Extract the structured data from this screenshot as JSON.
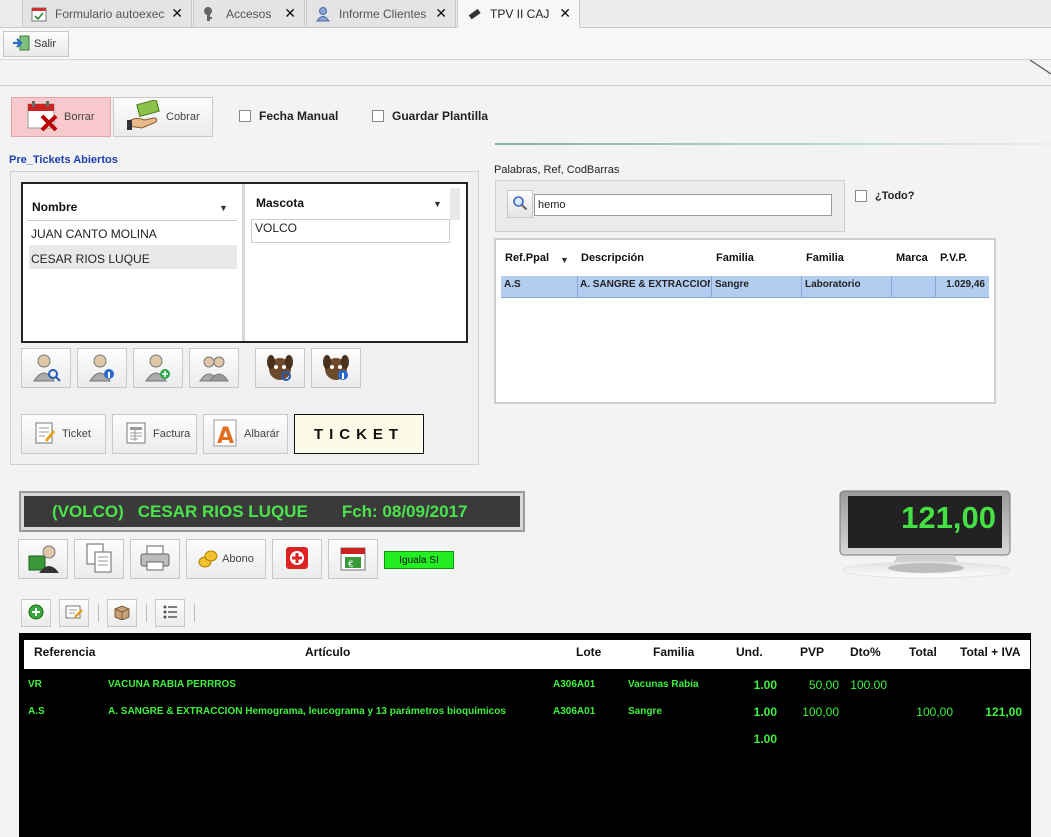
{
  "tabs": [
    {
      "label": "Formulario autoexec",
      "icon": "calendar-check-icon"
    },
    {
      "label": "Accesos",
      "icon": "key-icon"
    },
    {
      "label": "Informe Clientes",
      "icon": "user-icon"
    },
    {
      "label": "TPV II CAJ",
      "icon": "usb-stick-icon"
    }
  ],
  "toolbar": {
    "salir": "Salir"
  },
  "actions": {
    "borrar": "Borrar",
    "cobrar": "Cobrar",
    "fecha_manual": "Fecha Manual",
    "guardar_plantilla": "Guardar Plantilla"
  },
  "pretickets": {
    "title": "Pre_Tickets Abiertos",
    "col_nombre": "Nombre",
    "col_mascota": "Mascota",
    "clients": [
      "JUAN CANTO MOLINA",
      "CESAR RIOS LUQUE"
    ],
    "pets": [
      "VOLCO"
    ]
  },
  "docs": {
    "ticket": "Ticket",
    "factura": "Factura",
    "albaran": "Albarár",
    "ticket_big": "TICKET"
  },
  "search": {
    "label": "Palabras, Ref, CodBarras",
    "value": "hemo",
    "todo_label": "¿Todo?",
    "headers": [
      "Ref.Ppal",
      "Descripción",
      "Familia",
      "Familia",
      "Marca",
      "P.V.P."
    ],
    "row": {
      "ref": "A.S",
      "desc": "A. SANGRE & EXTRACCION ...",
      "fam1": "Sangre",
      "fam2": "Laboratorio",
      "marca": "",
      "pvp": "1.029,46"
    }
  },
  "banner": {
    "pet": "(VOLCO)",
    "client": "CESAR RIOS LUQUE",
    "date": "Fch: 08/09/2017"
  },
  "total_display": "121,00",
  "buttons": {
    "abono": "Abono",
    "iguala": "Iguala SI"
  },
  "lines": {
    "headers": [
      "Referencia",
      "Artículo",
      "Lote",
      "Familia",
      "Und.",
      "PVP",
      "Dto%",
      "Total",
      "Total + IVA"
    ],
    "rows": [
      {
        "ref": "VR",
        "art": "VACUNA RABIA PERRROS",
        "lote": "A306A01",
        "fam": "Vacunas Rabia",
        "und": "1.00",
        "pvp": "50,00",
        "dto": "100.00",
        "total": "",
        "iva": ""
      },
      {
        "ref": "A.S",
        "art": "A. SANGRE & EXTRACCION  Hemograma, leucograma y 13 parámetros bioquímicos",
        "lote": "A306A01",
        "fam": "Sangre",
        "und": "1.00",
        "pvp": "100,00",
        "dto": "",
        "total": "100,00",
        "iva": "121,00"
      },
      {
        "ref": "",
        "art": "",
        "lote": "",
        "fam": "",
        "und": "1.00",
        "pvp": "",
        "dto": "",
        "total": "",
        "iva": ""
      }
    ]
  },
  "colors": {
    "accent_green": "#3ef03e",
    "banner_text": "#4be34b",
    "selection": "#b3cdf0",
    "borrar_bg": "#f8c9cc"
  }
}
